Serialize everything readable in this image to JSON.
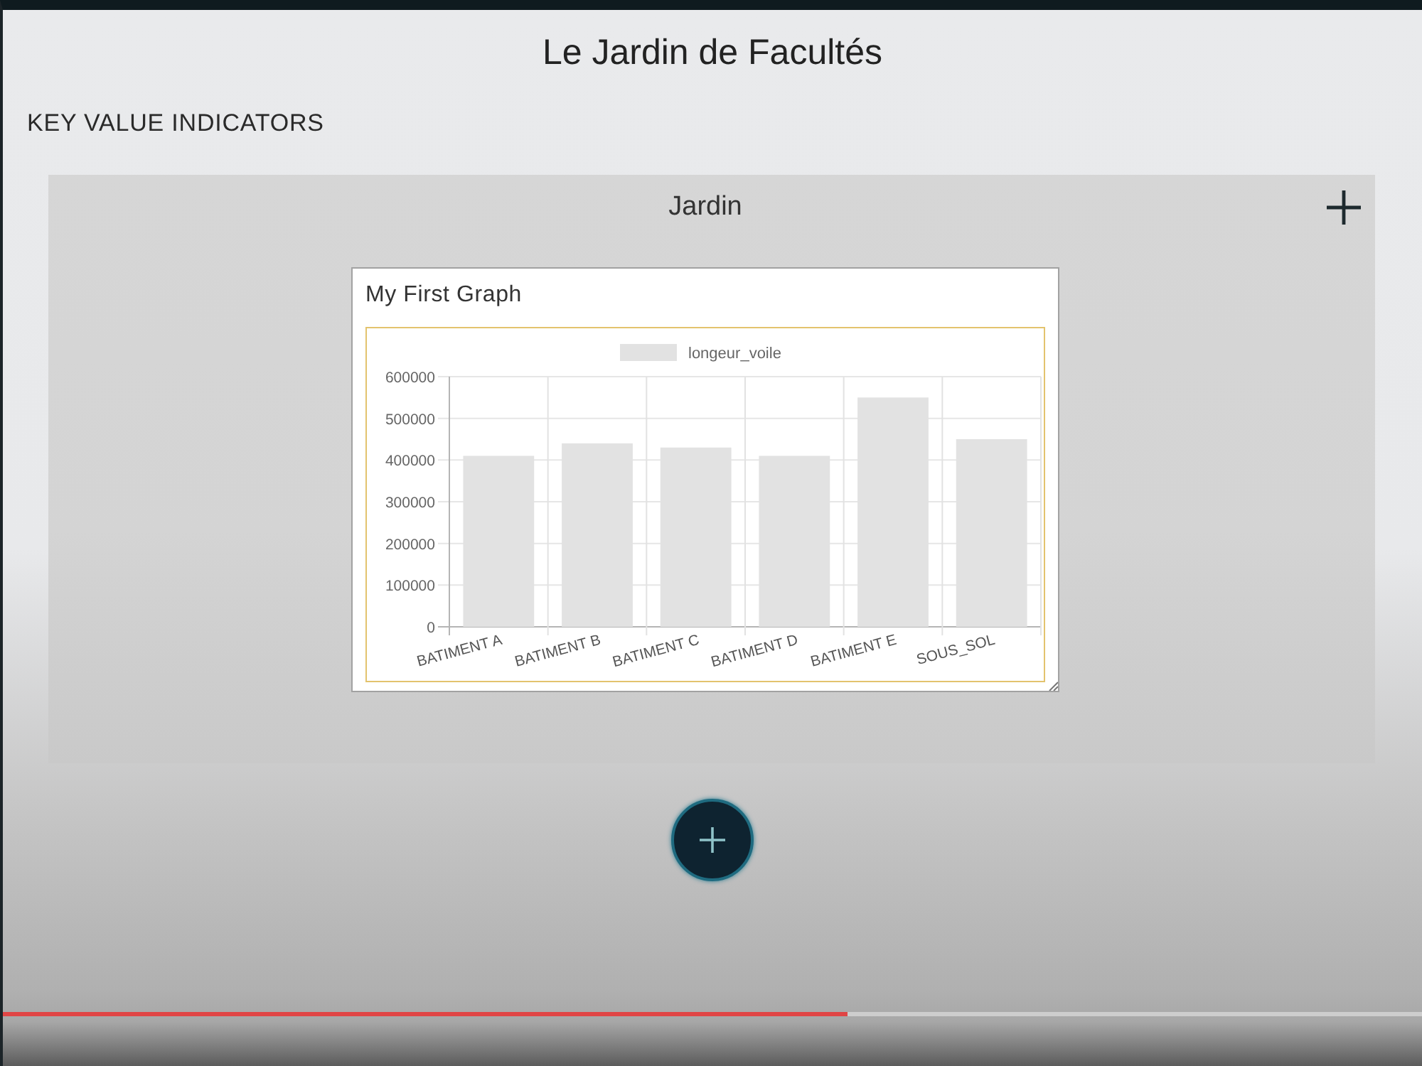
{
  "header": {
    "title": "Le Jardin de Facultés",
    "section_title": "KEY VALUE INDICATORS"
  },
  "panel": {
    "title": "Jardin",
    "card": {
      "title": "My First Graph",
      "chart_data": [
        {
          "type": "bar",
          "categories": [
            "BATIMENT A",
            "BATIMENT B",
            "BATIMENT C",
            "BATIMENT D",
            "BATIMENT E",
            "SOUS_SOL"
          ],
          "series": [
            {
              "name": "longeur_voile",
              "color": "#e2e2e2",
              "values": [
                410000,
                440000,
                430000,
                410000,
                550000,
                450000
              ]
            }
          ],
          "ylim": [
            0,
            600000
          ],
          "yticks": [
            0,
            100000,
            200000,
            300000,
            400000,
            500000,
            600000
          ],
          "grid": true,
          "legend": "top"
        }
      ]
    }
  },
  "video_progress": {
    "level": 0.595
  }
}
